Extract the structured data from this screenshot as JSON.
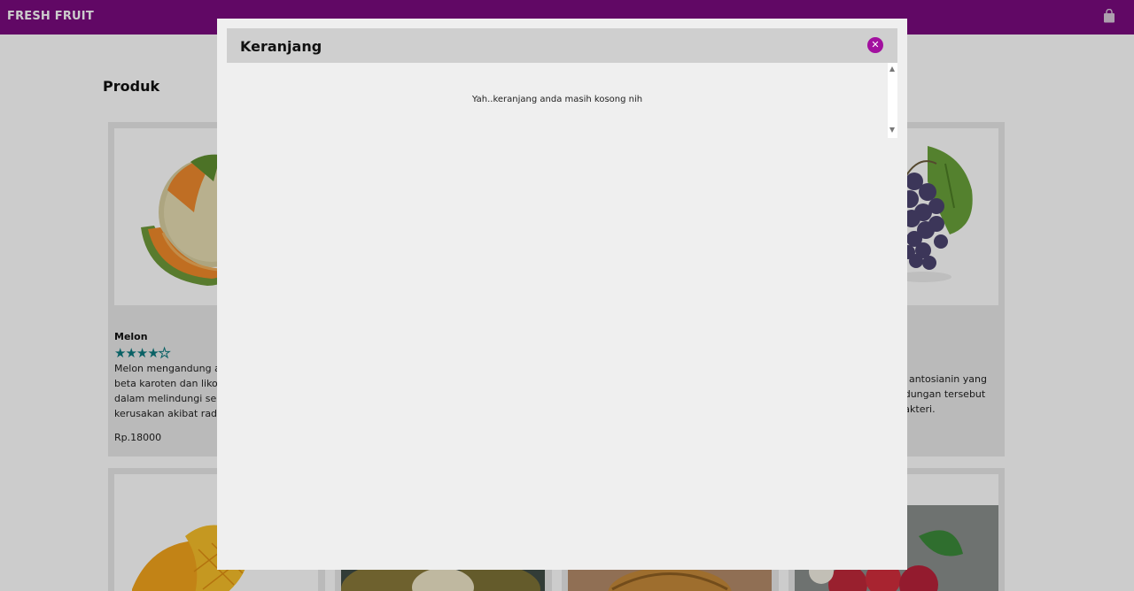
{
  "navbar": {
    "brand": "FRESH FRUIT",
    "cart_icon": "shopping-bag-icon"
  },
  "page": {
    "title": "Produk"
  },
  "products": [
    {
      "name": "Melon",
      "rating": 4,
      "rating_max": 5,
      "description": "Melon mengandung antioksidan berupa beta karoten dan likopen, yang berperan dalam melindungi sel-sel tubuh dari kerusakan akibat radikal bebas.",
      "price": "Rp.18000"
    },
    {
      "description_visible": "awa antosianin yang Kandungan tersebut el bakteri."
    }
  ],
  "modal": {
    "title": "Keranjang",
    "close_icon": "close-icon",
    "empty_message": "Yah..keranjang anda masih kosong nih"
  },
  "colors": {
    "navbar": "#7a0a7f",
    "accent": "#a2109f",
    "star": "#0d7a7f"
  }
}
